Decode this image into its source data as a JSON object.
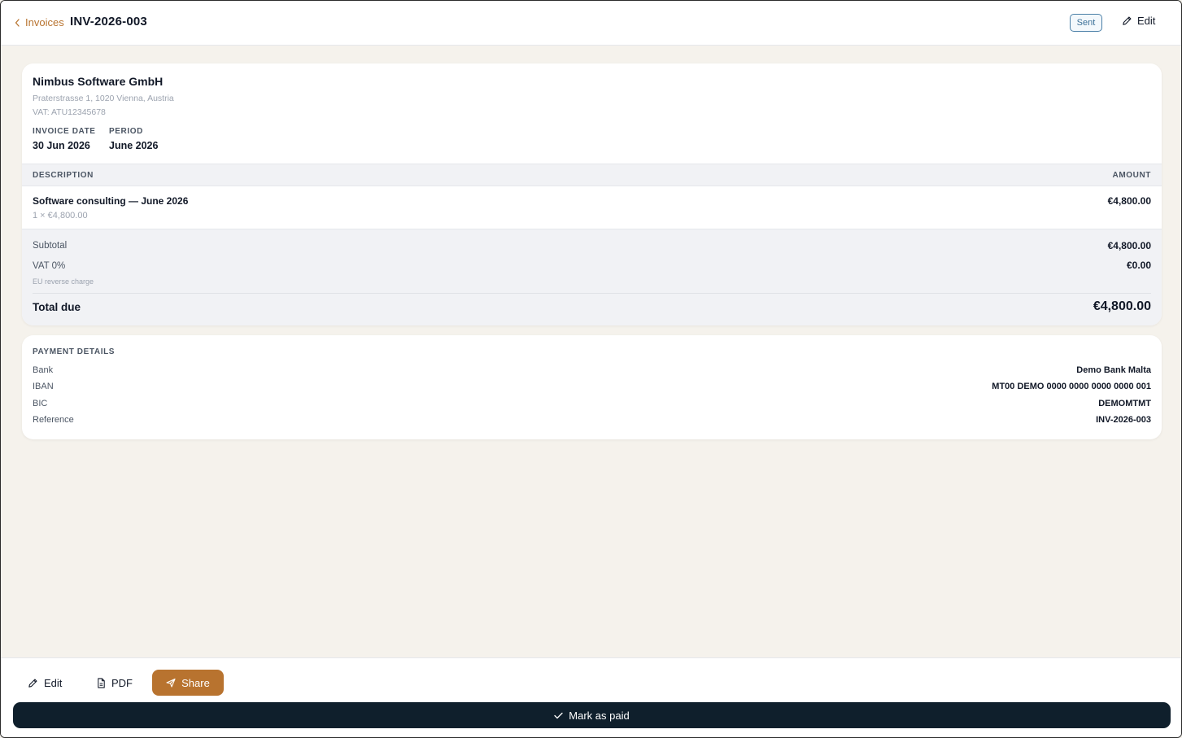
{
  "header": {
    "back_label": "Invoices",
    "invoice_number": "INV-2026-003",
    "status": "Sent",
    "edit_label": "Edit"
  },
  "company": {
    "name": "Nimbus Software GmbH",
    "address": "Praterstrasse 1, 1020 Vienna, Austria",
    "vat": "VAT: ATU12345678"
  },
  "meta": {
    "invoice_date_label": "INVOICE DATE",
    "invoice_date": "30 Jun 2026",
    "period_label": "PERIOD",
    "period": "June 2026"
  },
  "table": {
    "headers": {
      "description": "DESCRIPTION",
      "amount": "AMOUNT"
    },
    "items": [
      {
        "description": "Software consulting — June 2026",
        "quantity": "1 × €4,800.00",
        "amount": "€4,800.00"
      }
    ]
  },
  "totals": {
    "subtotal_label": "Subtotal",
    "subtotal": "€4,800.00",
    "vat_label": "VAT 0%",
    "vat": "€0.00",
    "vat_note": "EU reverse charge",
    "total_label": "Total due",
    "total": "€4,800.00"
  },
  "payment": {
    "title": "PAYMENT DETAILS",
    "rows": [
      {
        "label": "Bank",
        "value": "Demo Bank Malta"
      },
      {
        "label": "IBAN",
        "value": "MT00 DEMO 0000 0000 0000 0000 001"
      },
      {
        "label": "BIC",
        "value": "DEMOMTMT"
      },
      {
        "label": "Reference",
        "value": "INV-2026-003"
      }
    ]
  },
  "actions": {
    "edit_label": "Edit",
    "pdf_label": "PDF",
    "share_label": "Share",
    "mark_paid_label": "Mark as paid"
  },
  "icons": {
    "back": "chevron-left-icon",
    "edit": "pencil-icon",
    "pdf": "document-icon",
    "share": "send-icon",
    "check": "check-icon"
  },
  "colors": {
    "accent": "#b8732f",
    "primary_dark": "#0f1f2c",
    "status_border": "#4a7fa7",
    "page_background": "#f5f2ec"
  }
}
